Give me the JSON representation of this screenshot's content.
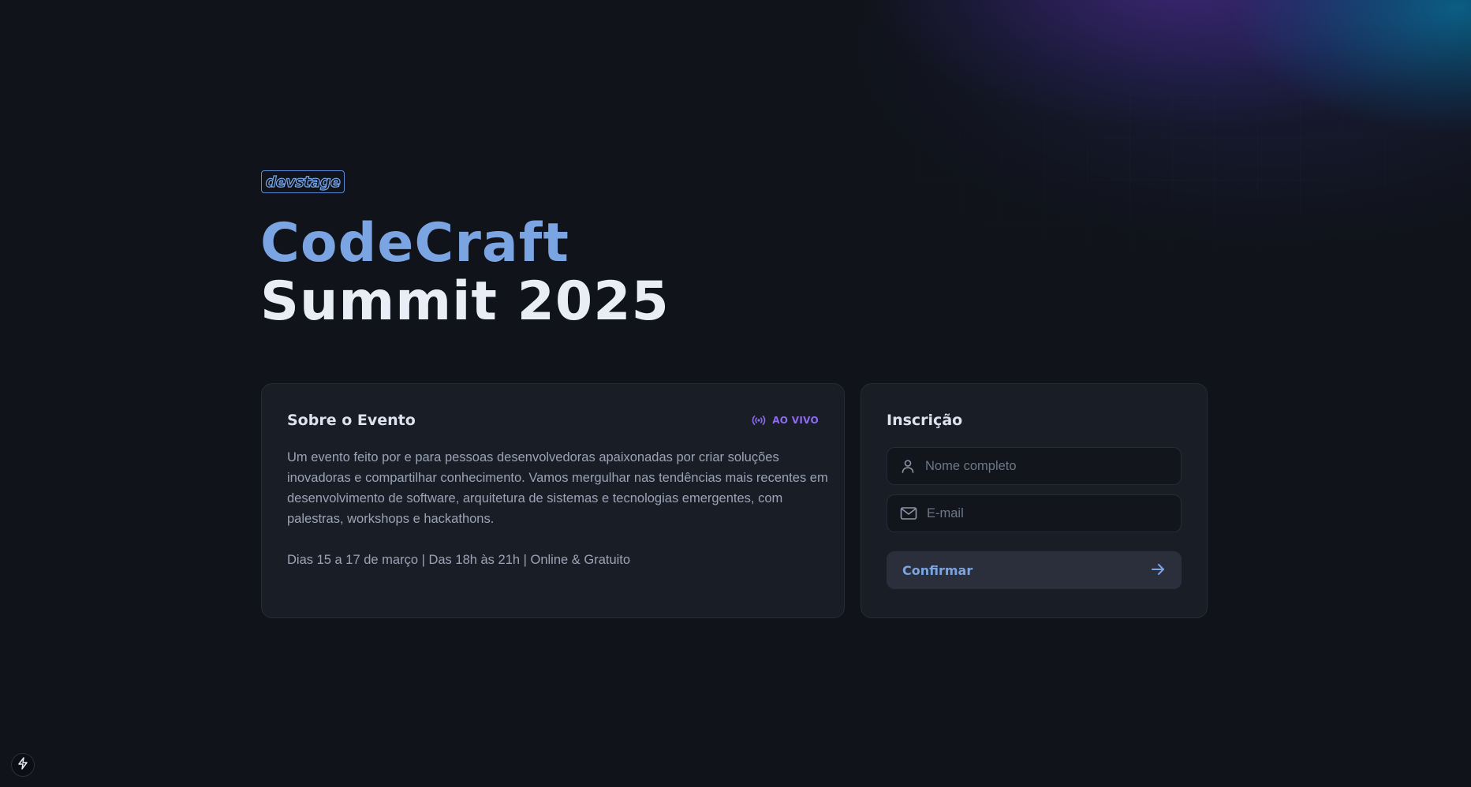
{
  "brand": {
    "logo_text": "devstage"
  },
  "hero": {
    "title_line1": "CodeCraft",
    "title_line2": "Summit 2025"
  },
  "about": {
    "title": "Sobre o Evento",
    "live_badge": "AO VIVO",
    "description": "Um evento feito por e para pessoas desenvolvedoras apaixonadas por criar soluções inovadoras e compartilhar conhecimento. Vamos mergulhar nas tendências mais recentes em desenvolvimento de software, arquitetura de sistemas e tecnologias emergentes, com palestras, workshops e hackathons.",
    "event_info": "Dias 15 a 17 de março | Das 18h às 21h | Online & Gratuito"
  },
  "signup": {
    "title": "Inscrição",
    "name_placeholder": "Nome completo",
    "name_value": "",
    "email_placeholder": "E-mail",
    "email_value": "",
    "confirm_label": "Confirmar"
  },
  "icons": {
    "live": "radio-signal-icon",
    "name_field": "user-icon",
    "email_field": "mail-icon",
    "confirm": "arrow-right-icon",
    "devtools": "bolt-icon"
  },
  "colors": {
    "background": "#10131a",
    "card": "#191d26",
    "accent_blue": "#7ba4e2",
    "accent_purple": "#8e6cf0",
    "title_white": "#e8edf6",
    "muted_text": "#9aa4b5"
  }
}
